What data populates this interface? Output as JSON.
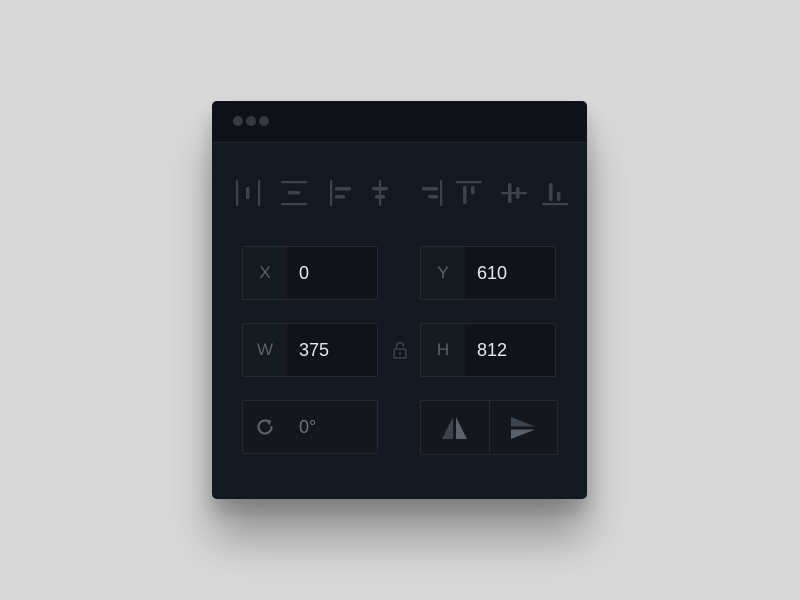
{
  "window": {
    "traffic_lights": [
      "close",
      "minimize",
      "zoom"
    ]
  },
  "alignment_toolbar": {
    "icons": [
      "distribute-horizontal-icon",
      "distribute-vertical-icon",
      "align-left-icon",
      "align-center-horizontal-icon",
      "align-right-icon",
      "align-top-icon",
      "align-middle-vertical-icon",
      "align-bottom-icon"
    ]
  },
  "position": {
    "x_label": "X",
    "x_value": "0",
    "y_label": "Y",
    "y_value": "610"
  },
  "size": {
    "w_label": "W",
    "w_value": "375",
    "h_label": "H",
    "h_value": "812",
    "lock_icon": "unlock-icon"
  },
  "rotation": {
    "icon": "rotate-icon",
    "value": "0°"
  },
  "flip": {
    "horizontal_icon": "flip-horizontal-icon",
    "vertical_icon": "flip-vertical-icon"
  },
  "colors": {
    "panel_bg": "#141820",
    "titlebar_bg": "#0e1116",
    "border": "#242933",
    "label_text": "#5b616b",
    "value_text": "#e6e8eb",
    "icon": "#3d434c",
    "page_bg": "#d9d9d9"
  }
}
